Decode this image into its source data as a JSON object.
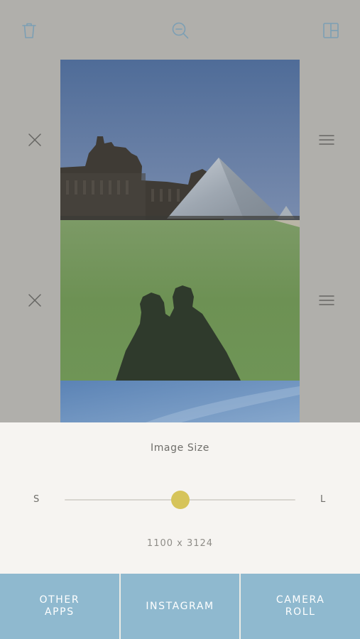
{
  "toolbar": {
    "delete_icon": "trash-icon",
    "zoom_icon": "zoom-out-icon",
    "layout_icon": "layout-icon"
  },
  "rows": [
    {
      "remove_icon": "close-icon",
      "reorder_icon": "drag-handle-icon"
    },
    {
      "remove_icon": "close-icon",
      "reorder_icon": "drag-handle-icon"
    }
  ],
  "panel": {
    "title": "Image Size",
    "min_label": "S",
    "max_label": "L",
    "slider_value": 0.5,
    "dimensions": "1100 x 3124"
  },
  "share": [
    {
      "label": "OTHER\nAPPS"
    },
    {
      "label": "INSTAGRAM"
    },
    {
      "label": "CAMERA\nROLL"
    }
  ],
  "colors": {
    "background": "#b0afab",
    "panel": "#f6f4f1",
    "accent": "#d6c45a",
    "share_bar": "#8fb9cf"
  }
}
